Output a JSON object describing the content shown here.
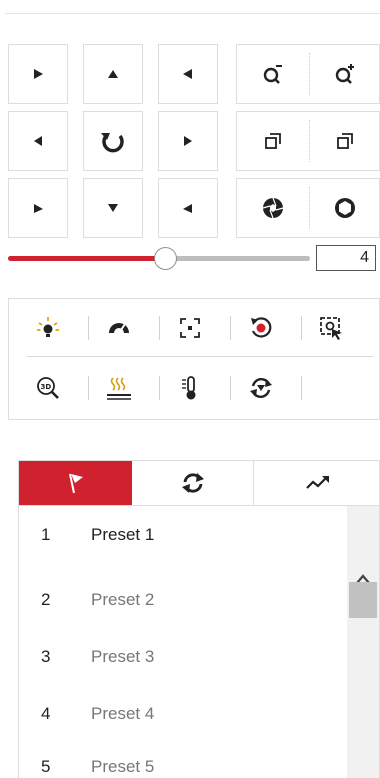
{
  "ptz_pad": {
    "buttons": [
      {
        "name": "pan-up-left-button",
        "icon": "triangle-right"
      },
      {
        "name": "tilt-up-button",
        "icon": "triangle-up"
      },
      {
        "name": "pan-up-right-button",
        "icon": "triangle-left"
      },
      {
        "name": "pan-left-button",
        "icon": "triangle-left"
      },
      {
        "name": "auto-pan-button",
        "icon": "rotate-icon"
      },
      {
        "name": "pan-right-button",
        "icon": "triangle-right"
      },
      {
        "name": "pan-down-left-button",
        "icon": "triangle-up"
      },
      {
        "name": "tilt-down-button",
        "icon": "triangle-down"
      },
      {
        "name": "pan-down-right-button",
        "icon": "triangle-up-left"
      }
    ]
  },
  "lens_controls": {
    "zoom": [
      "zoom-out-icon",
      "zoom-in-icon"
    ],
    "focus": [
      "focus-near-icon",
      "focus-far-icon"
    ],
    "iris": [
      "iris-close-icon",
      "iris-open-icon"
    ]
  },
  "speed": {
    "value": "4",
    "fill_percent": 52
  },
  "functions": {
    "row1": [
      "light-icon",
      "wiper-icon",
      "auxiliary-focus-icon",
      "lens-initialization-icon",
      "manual-tracking-icon"
    ],
    "row2": [
      "3d-positioning-icon",
      "heater-icon",
      "temperature-icon",
      "one-touch-patrol-icon"
    ]
  },
  "tabs": [
    {
      "name": "tab-preset",
      "icon": "flag-icon",
      "active": true
    },
    {
      "name": "tab-patrol",
      "icon": "refresh-icon",
      "active": false
    },
    {
      "name": "tab-pattern",
      "icon": "trend-line-icon",
      "active": false
    }
  ],
  "presets": [
    {
      "num": "1",
      "name": "Preset 1"
    },
    {
      "num": "2",
      "name": "Preset 2"
    },
    {
      "num": "3",
      "name": "Preset 3"
    },
    {
      "num": "4",
      "name": "Preset 4"
    },
    {
      "num": "5",
      "name": "Preset 5"
    }
  ],
  "colors": {
    "accent": "#d0212f",
    "icon_dark": "#222222",
    "muted_text": "#777777",
    "track": "#bdbdbd"
  }
}
